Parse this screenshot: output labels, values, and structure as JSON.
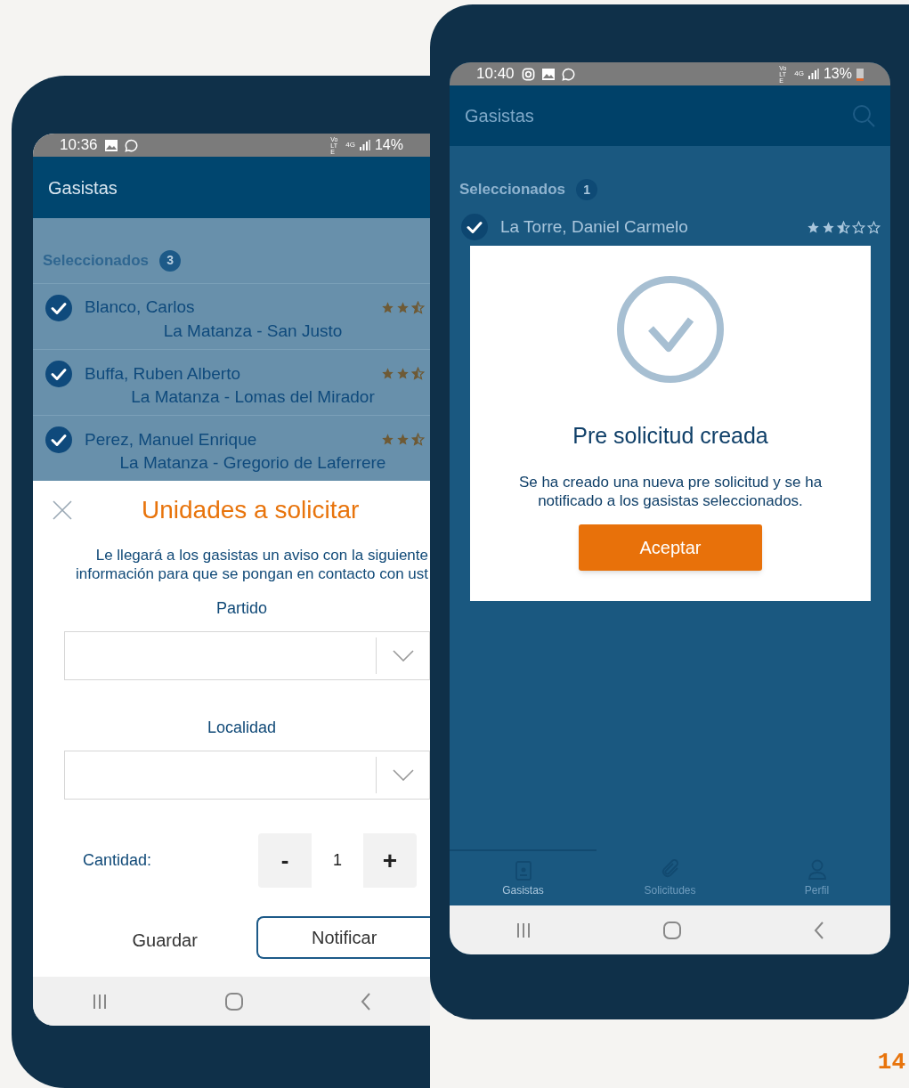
{
  "phones": [
    {
      "kind": "form",
      "status": {
        "time": "10:36",
        "volte": "Vo LTE",
        "network": "4G",
        "battery": "14%"
      },
      "app_title": "Gasistas",
      "selected_label": "Seleccionados",
      "selected_count": "3",
      "providers": [
        {
          "name": "Blanco, Carlos",
          "location": "La Matanza - San Justo",
          "stars": 2.5,
          "checked": true
        },
        {
          "name": "Buffa, Ruben Alberto",
          "location": "La Matanza - Lomas del Mirador",
          "stars": 2.5,
          "checked": true
        },
        {
          "name": "Perez, Manuel Enrique",
          "location": "La Matanza - Gregorio de Laferrere",
          "stars": 2.5,
          "checked": true
        }
      ],
      "sheet": {
        "title": "Unidades a solicitar",
        "message_lines": [
          "Le llegará a los gasistas un aviso con la siguiente",
          "información para que se pongan en contacto con ust"
        ],
        "fields": [
          {
            "label": "Partido"
          },
          {
            "label": "Localidad"
          }
        ],
        "quantity": {
          "label": "Cantidad:",
          "decrement": "-",
          "value": "1",
          "increment": "+"
        },
        "buttons": [
          {
            "label": "Guardar",
            "kind": "text"
          },
          {
            "label": "Notificar",
            "kind": "outlined"
          }
        ]
      }
    },
    {
      "kind": "dialog",
      "status": {
        "time": "10:40",
        "volte": "Vo LTE",
        "network": "4G",
        "battery": "13%"
      },
      "app_title": "Gasistas",
      "selected_label": "Seleccionados",
      "selected_count": "1",
      "providers": [
        {
          "name": "La Torre, Daniel Carmelo",
          "stars": 2.5,
          "checked": true
        }
      ],
      "bottom_tabs": [
        {
          "label": "Gasistas",
          "selected": true
        },
        {
          "label": "Solicitudes",
          "selected": false
        },
        {
          "label": "Perfil",
          "selected": false
        }
      ],
      "dialog": {
        "title": "Pre solicitud creada",
        "message": "Se ha creado una nueva pre solicitud y se ha notificado a los gasistas seleccionados.",
        "button": "Aceptar"
      }
    }
  ],
  "page_number": "14"
}
